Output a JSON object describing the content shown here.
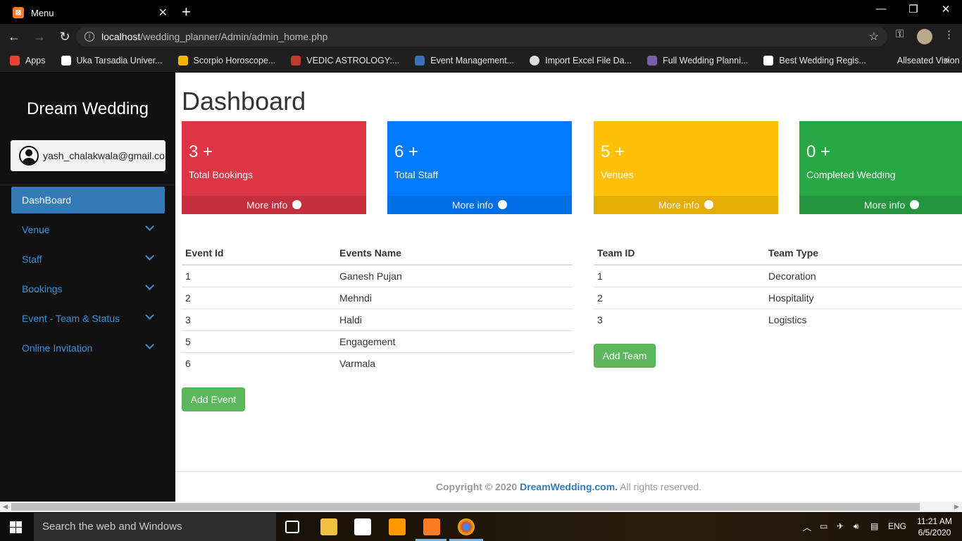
{
  "browser": {
    "tab_title": "Menu",
    "tab_favicon_text": "⊠",
    "url_host": "localhost",
    "url_path": "/wedding_planner/Admin/admin_home.php",
    "bookmarks": [
      {
        "label": "Apps",
        "color": "#e94235"
      },
      {
        "label": "Uka Tarsadia Univer...",
        "color": "#ffffff"
      },
      {
        "label": "Scorpio Horoscope...",
        "color": "#f4b400"
      },
      {
        "label": "VEDIC ASTROLOGY:...",
        "color": "#c0392b"
      },
      {
        "label": "Event Management...",
        "color": "#3b6fb6"
      },
      {
        "label": "Import Excel File Da...",
        "color": "#dddddd"
      },
      {
        "label": "Full Wedding Planni...",
        "color": "#7a5ea8"
      },
      {
        "label": "Best Wedding Regis...",
        "color": "#ffffff"
      },
      {
        "label": "Allseated Vision",
        "color": "#1f1f1f"
      }
    ]
  },
  "sidebar": {
    "brand": "Dream Wedding",
    "user_email": "yash_chalakwala@gmail.com",
    "items": [
      {
        "label": "DashBoard",
        "active": true
      },
      {
        "label": "Venue"
      },
      {
        "label": "Staff"
      },
      {
        "label": "Bookings"
      },
      {
        "label": "Event - Team & Status"
      },
      {
        "label": "Online Invitation"
      }
    ]
  },
  "main": {
    "title": "Dashboard",
    "cards": [
      {
        "count": "3 +",
        "label": "Total Bookings",
        "footer": "More info",
        "color": "#dc3545"
      },
      {
        "count": "6 +",
        "label": "Total Staff",
        "footer": "More info",
        "color": "#007bff"
      },
      {
        "count": "5 +",
        "label": "Venues",
        "footer": "More info",
        "color": "#ffc107"
      },
      {
        "count": "0 +",
        "label": "Completed Wedding",
        "footer": "More info",
        "color": "#28a745"
      }
    ],
    "events_table": {
      "headers": [
        "Event Id",
        "Events Name"
      ],
      "rows": [
        [
          "1",
          "Ganesh Pujan"
        ],
        [
          "2",
          "Mehndi"
        ],
        [
          "3",
          "Haldi"
        ],
        [
          "5",
          "Engagement"
        ],
        [
          "6",
          "Varmala"
        ]
      ],
      "add_button": "Add Event"
    },
    "teams_table": {
      "headers": [
        "Team ID",
        "Team Type"
      ],
      "rows": [
        [
          "1",
          "Decoration"
        ],
        [
          "2",
          "Hospitality"
        ],
        [
          "3",
          "Logistics"
        ]
      ],
      "add_button": "Add Team"
    },
    "footer": {
      "copyright": "Copyright © 2020",
      "site": "DreamWedding.com.",
      "rights": "All rights reserved."
    }
  },
  "taskbar": {
    "search_placeholder": "Search the web and Windows",
    "language": "ENG",
    "time": "11:21 AM",
    "date": "6/5/2020"
  }
}
